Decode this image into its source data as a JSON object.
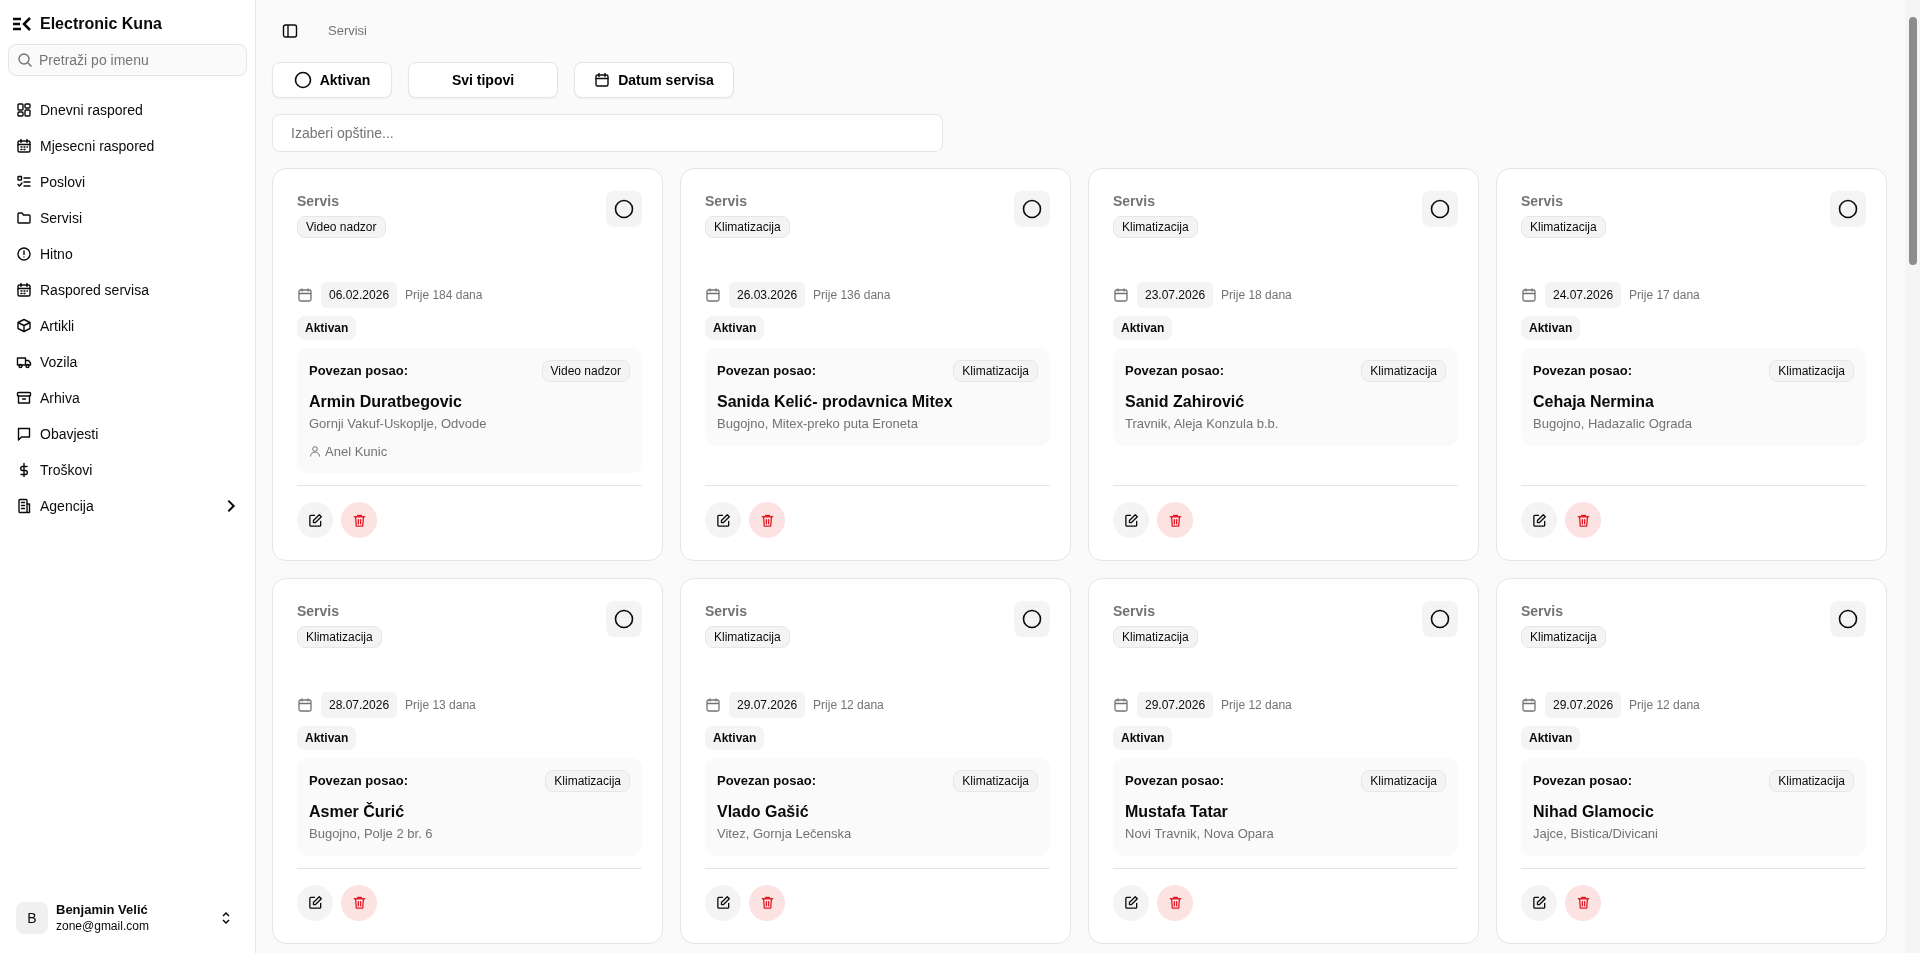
{
  "app": {
    "title": "Electronic Kuna",
    "search": {
      "placeholder": "Pretraži po imenu"
    }
  },
  "sidebar": {
    "items": [
      {
        "label": "Dnevni raspored",
        "submenu": false
      },
      {
        "label": "Mjesecni raspored",
        "submenu": false
      },
      {
        "label": "Poslovi",
        "submenu": false
      },
      {
        "label": "Servisi",
        "submenu": false
      },
      {
        "label": "Hitno",
        "submenu": false
      },
      {
        "label": "Raspored servisa",
        "submenu": false
      },
      {
        "label": "Artikli",
        "submenu": false
      },
      {
        "label": "Vozila",
        "submenu": false
      },
      {
        "label": "Arhiva",
        "submenu": false
      },
      {
        "label": "Obavjesti",
        "submenu": false
      },
      {
        "label": "Troškovi",
        "submenu": false
      },
      {
        "label": "Agencija",
        "submenu": true
      }
    ]
  },
  "user": {
    "initial": "B",
    "name": "Benjamin Velić",
    "email": "zone@gmail.com"
  },
  "breadcrumb": "Servisi",
  "filters": [
    {
      "kind": "status",
      "label": "Aktivan"
    },
    {
      "kind": "type",
      "label": "Svi tipovi"
    },
    {
      "kind": "date",
      "label": "Datum servisa"
    }
  ],
  "municipality": {
    "placeholder": "Izaberi opštine..."
  },
  "cards": [
    {
      "title": "Servis",
      "type": "Video nadzor",
      "date": "06.02.2026",
      "ago": "Prije 184 dana",
      "status": "Aktivan",
      "done": false,
      "job_label": "Povezan posao:",
      "job_type": "Video nadzor",
      "client": "Armin Duratbegovic",
      "address": "Gornji Vakuf-Uskoplje, Odvode",
      "person": "Anel Kunic"
    },
    {
      "title": "Servis",
      "type": "Klimatizacija",
      "date": "26.03.2026",
      "ago": "Prije 136 dana",
      "status": "Aktivan",
      "done": false,
      "job_label": "Povezan posao:",
      "job_type": "Klimatizacija",
      "client": "Sanida Kelić- prodavnica Mitex",
      "address": "Bugojno, Mitex-preko puta Eroneta"
    },
    {
      "title": "Servis",
      "type": "Klimatizacija",
      "date": "23.07.2026",
      "ago": "Prije 18 dana",
      "status": "Aktivan",
      "done": false,
      "job_label": "Povezan posao:",
      "job_type": "Klimatizacija",
      "client": "Sanid Zahirović",
      "address": "Travnik, Aleja Konzula b.b."
    },
    {
      "title": "Servis",
      "type": "Klimatizacija",
      "date": "24.07.2026",
      "ago": "Prije 17 dana",
      "status": "Aktivan",
      "done": false,
      "job_label": "Povezan posao:",
      "job_type": "Klimatizacija",
      "client": "Cehaja Nermina",
      "address": "Bugojno, Hadazalic Ograda"
    },
    {
      "title": "Servis",
      "type": "Klimatizacija",
      "date": "28.07.2026",
      "ago": "Prije 13 dana",
      "status": "Aktivan",
      "done": false,
      "job_label": "Povezan posao:",
      "job_type": "Klimatizacija",
      "client": "Asmer Čurić",
      "address": "Bugojno, Polje 2 br. 6"
    },
    {
      "title": "Servis",
      "type": "Klimatizacija",
      "date": "29.07.2026",
      "ago": "Prije 12 dana",
      "status": "Aktivan",
      "done": false,
      "job_label": "Povezan posao:",
      "job_type": "Klimatizacija",
      "client": "Vlado Gašić",
      "address": "Vitez, Gornja Lečenska"
    },
    {
      "title": "Servis",
      "type": "Klimatizacija",
      "date": "29.07.2026",
      "ago": "Prije 12 dana",
      "status": "Aktivan",
      "done": false,
      "job_label": "Povezan posao:",
      "job_type": "Klimatizacija",
      "client": "Mustafa Tatar",
      "address": "Novi Travnik, Nova Opara"
    },
    {
      "title": "Servis",
      "type": "Klimatizacija",
      "date": "29.07.2026",
      "ago": "Prije 12 dana",
      "status": "Aktivan",
      "done": false,
      "job_label": "Povezan posao:",
      "job_type": "Klimatizacija",
      "client": "Nihad Glamocic",
      "address": "Jajce, Bistica/Divicani"
    }
  ]
}
